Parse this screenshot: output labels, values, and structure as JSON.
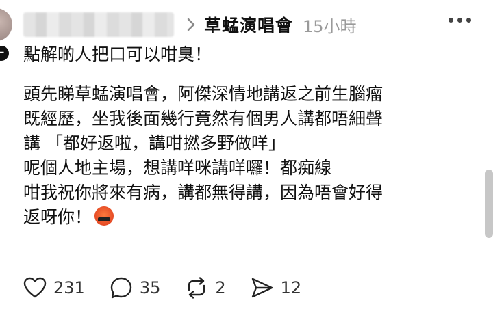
{
  "header": {
    "group_name": "草蜢演唱會",
    "time": "15小時"
  },
  "post": {
    "lines": [
      "點解啲人把口可以咁臭！",
      "頭先睇草蜢演唱會，阿傑深情地講返之前生腦瘤",
      "既經歷，坐我後面幾行竟然有個男人講都唔細聲",
      "講 「都好返啦，講咁撚多野做咩」",
      "呢個人地主場，想講咩咪講咩囉！都痴線",
      "咁我祝你將來有病，講都無得講，因為唔會好得",
      "返呀你！"
    ]
  },
  "actions": {
    "likes": "231",
    "comments": "35",
    "reposts": "2",
    "shares": "12"
  }
}
